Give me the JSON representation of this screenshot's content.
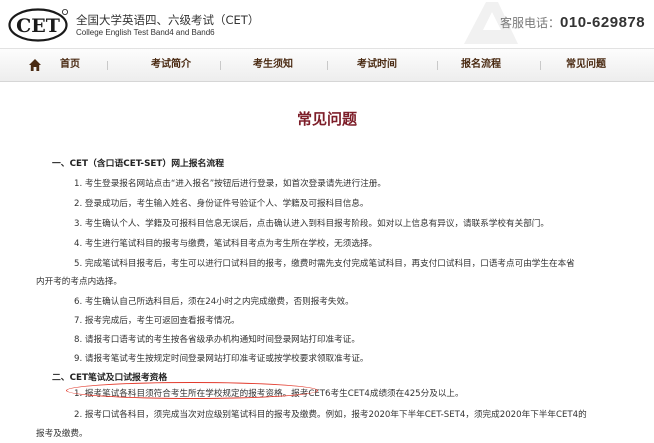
{
  "header": {
    "logo_text": "CET",
    "site_name_cn": "全国大学英语四、六级考试（CET）",
    "site_name_en": "College English Test Band4 and Band6",
    "hotline_label": "客服电话：",
    "hotline_number": "010-629878"
  },
  "nav": {
    "items": [
      {
        "label": "首页"
      },
      {
        "label": "考试简介"
      },
      {
        "label": "考生须知"
      },
      {
        "label": "考试时间"
      },
      {
        "label": "报名流程"
      },
      {
        "label": "常见问题"
      }
    ]
  },
  "content": {
    "title": "常见问题",
    "sections": [
      {
        "heading": "一、CET（含口语CET-SET）网上报名流程",
        "items": [
          "1. 考生登录报名网站点击“进入报名”按钮后进行登录，如首次登录请先进行注册。",
          "2. 登录成功后，考生输入姓名、身份证件号验证个人、学籍及可报科目信息。",
          "3. 考生确认个人、学籍及可报科目信息无误后，点击确认进入到科目报考阶段。如对以上信息有异议，请联系学校有关部门。",
          "4. 考生进行笔试科目的报考与缴费，笔试科目考点为考生所在学校，无须选择。",
          "5. 完成笔试科目报考后，考生可以进行口试科目的报考，缴费时需先支付完成笔试科目，再支付口试科目，口语考点可由学生在本省",
          "内开考的考点内选择。",
          "6. 考生确认自己所选科目后，须在24小时之内完成缴费，否则报考失效。",
          "7. 报考完成后，考生可返回查看报考情况。",
          "8. 请报考口语考试的考生按各省级承办机构通知时间登录网站打印准考证。",
          "9. 请报考笔试考生按规定时间登录网站打印准考证或按学校要求领取准考证。"
        ]
      },
      {
        "heading": "二、CET笔试及口试报考资格",
        "items": [
          "1. 报考笔试各科目须符合考生所在学校规定的报考资格。报考CET6考生CET4成绩须在425分及以上。",
          "2. 报考口试各科目，须完成当次对应级别笔试科目的报考及缴费。例如，报考2020年下半年CET-SET4，须完成2020年下半年CET4的",
          "报考及缴费。"
        ]
      }
    ]
  }
}
